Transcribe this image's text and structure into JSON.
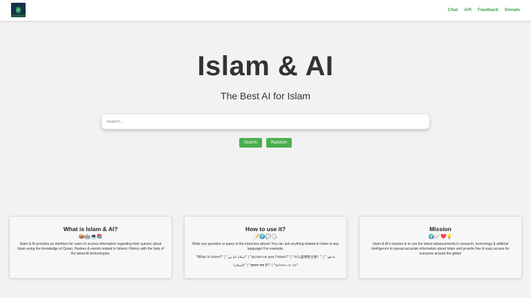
{
  "header": {
    "nav": [
      "Chat",
      "API",
      "Feedback",
      "Donate"
    ]
  },
  "hero": {
    "title": "Islam & AI",
    "subtitle": "The Best AI for Islam"
  },
  "search": {
    "placeholder": "Search...",
    "value": "",
    "search_label": "Search",
    "random_label": "Random"
  },
  "cards": [
    {
      "title": "What is Islam & AI?",
      "emoji": "📦🤖💻📚",
      "text": "Islam & AI provides an interface for users to access information regarding their queries about Islam using the knowledge of Quran, Hadees & events related to Islamic History with the help of the latest AI technologies."
    },
    {
      "title": "How to use it?",
      "emoji": "📝🌍💬🗣",
      "text": "Write any question or query in the input box above! You can ask anything related to Islam in any language! For example,",
      "examples": [
        "\"What is Islam?\" | \"اسلام کیا ہے\" | \"qu'est-ce que l'islam?\" | \"什么是伊斯兰教？\" | \" ما هو",
        "الإسلام؟\" | \"इस्लाम क्या है?\" | \"מה זה איסלאם\""
      ]
    },
    {
      "title": "Mission",
      "emoji": "🌍📈❤️💡",
      "text": "Islam & AI's mission is to use the latest advancements in research, technology & artificial intelligence to spread accurate information about Islam and provide free & easy access for everyone around the globe!"
    }
  ]
}
